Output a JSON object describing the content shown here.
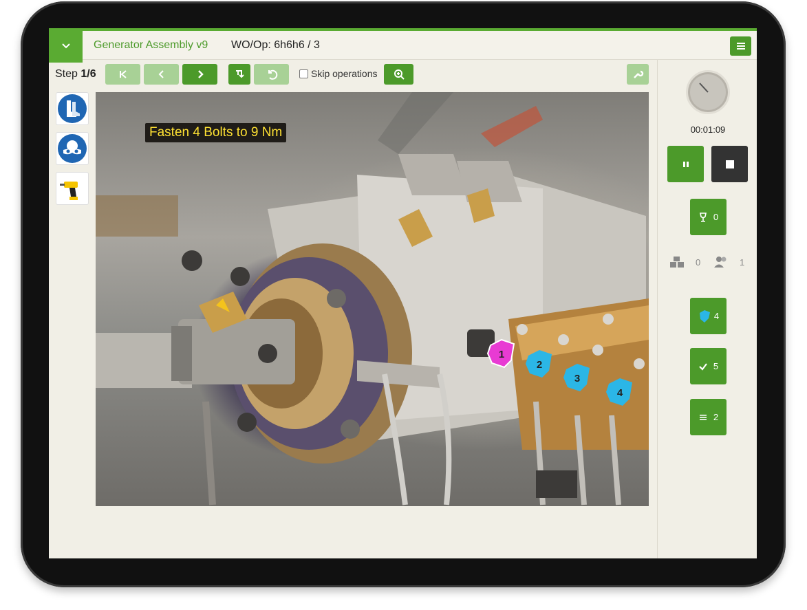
{
  "header": {
    "app_title": "Generator Assembly v9",
    "wo_op": "WO/Op: 6h6h6 / 3"
  },
  "toolbar": {
    "step_prefix": "Step",
    "step_value": "1/6",
    "skip_label": "Skip operations"
  },
  "instruction": "Fasten 4 Bolts to 9 Nm",
  "ppe": [
    "safety-boots-icon",
    "safety-goggles-icon",
    "power-drill-icon"
  ],
  "markers": [
    {
      "label": "1",
      "color": "#e83bd3"
    },
    {
      "label": "2",
      "color": "#2bb6e6"
    },
    {
      "label": "3",
      "color": "#2bb6e6"
    },
    {
      "label": "4",
      "color": "#2bb6e6"
    }
  ],
  "timer": "00:01:09",
  "sidebar": {
    "chip_count": "0",
    "parts_count": "0",
    "users_count": "1",
    "markers_count": "4",
    "checks_count": "5",
    "list_count": "2"
  },
  "colors": {
    "accent": "#4c9a2a",
    "accent_disabled": "#a8d196",
    "marker_active": "#e83bd3",
    "marker": "#2bb6e6"
  }
}
